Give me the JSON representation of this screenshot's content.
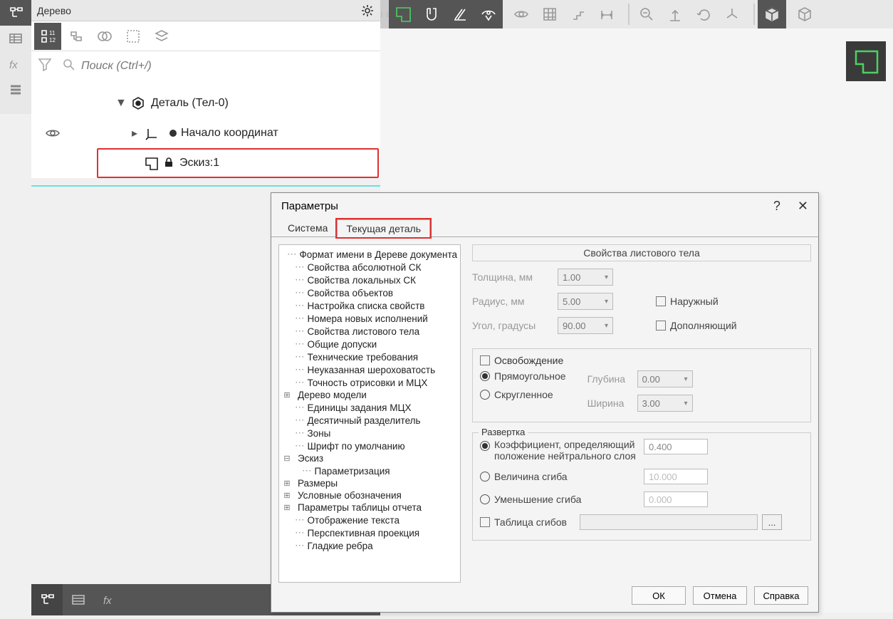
{
  "tree_panel": {
    "title": "Дерево",
    "search_placeholder": "Поиск (Ctrl+/)",
    "items": {
      "root": "Деталь (Тел-0)",
      "origin": "Начало координат",
      "sketch": "Эскиз:1"
    }
  },
  "dialog": {
    "title": "Параметры",
    "tabs": {
      "system": "Система",
      "current": "Текущая деталь"
    },
    "left_tree": [
      "Формат имени в Дереве документа",
      "Свойства абсолютной СК",
      "Свойства локальных СК",
      "Свойства объектов",
      "Настройка списка свойств",
      "Номера новых исполнений",
      "Свойства листового тела",
      "Общие допуски",
      "Технические требования",
      "Неуказанная шероховатость",
      "Точность отрисовки и МЦХ",
      "Дерево модели",
      "Единицы задания МЦХ",
      "Десятичный разделитель",
      "Зоны",
      "Шрифт по умолчанию",
      "Эскиз",
      "Параметризация",
      "Размеры",
      "Условные обозначения",
      "Параметры таблицы отчета",
      "Отображение текста",
      "Перспективная проекция",
      "Гладкие ребра"
    ],
    "group_header": "Свойства листового тела",
    "fields": {
      "thickness_lbl": "Толщина, мм",
      "thickness_val": "1.00",
      "radius_lbl": "Радиус, мм",
      "radius_val": "5.00",
      "angle_lbl": "Угол, градусы",
      "angle_val": "90.00",
      "outer_lbl": "Наружный",
      "complement_lbl": "Дополняющий",
      "release_lbl": "Освобождение",
      "rect_lbl": "Прямоугольное",
      "rounded_lbl": "Скругленное",
      "depth_lbl": "Глубина",
      "depth_val": "0.00",
      "width_lbl": "Ширина",
      "width_val": "3.00",
      "unfold_legend": "Развертка",
      "coef_lbl": "Коэффициент, определяющий положение нейтрального слоя",
      "coef_val": "0.400",
      "bend_lbl": "Величина сгиба",
      "bend_val": "10.000",
      "reduce_lbl": "Уменьшение сгиба",
      "reduce_val": "0.000",
      "table_lbl": "Таблица сгибов"
    },
    "buttons": {
      "ok": "ОК",
      "cancel": "Отмена",
      "help": "Справка",
      "browse": "..."
    }
  }
}
